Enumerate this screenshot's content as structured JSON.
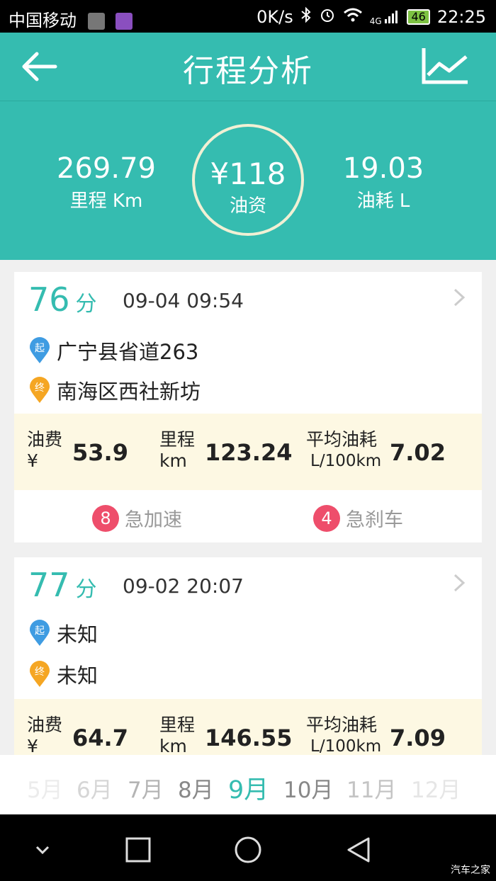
{
  "status_bar": {
    "carrier": "中国移动",
    "speed": "0K/s",
    "network": "4G",
    "battery": "46",
    "time": "22:25"
  },
  "header": {
    "title": "行程分析",
    "back_icon": "back-arrow-icon",
    "chart_icon": "line-chart-icon"
  },
  "summary": {
    "mileage": {
      "value": "269.79",
      "label": "里程 Km"
    },
    "cost": {
      "value": "¥118",
      "label": "油资"
    },
    "fuel": {
      "value": "19.03",
      "label": "油耗 L"
    }
  },
  "trips": [
    {
      "score": "76",
      "score_unit": "分",
      "datetime": "09-04 09:54",
      "start": "广宁县省道263",
      "end": "南海区西社新坊",
      "fee_label": "油费",
      "fee_unit": "¥",
      "fee": "53.9",
      "dist_label": "里程",
      "dist_unit": "km",
      "dist": "123.24",
      "avg_label": "平均油耗",
      "avg_unit": "L/100km",
      "avg": "7.02",
      "accel_count": "8",
      "accel_label": "急加速",
      "brake_count": "4",
      "brake_label": "急刹车"
    },
    {
      "score": "77",
      "score_unit": "分",
      "datetime": "09-02 20:07",
      "start": "未知",
      "end": "未知",
      "fee_label": "油费",
      "fee_unit": "¥",
      "fee": "64.7",
      "dist_label": "里程",
      "dist_unit": "km",
      "dist": "146.55",
      "avg_label": "平均油耗",
      "avg_unit": "L/100km",
      "avg": "7.09"
    }
  ],
  "pins": {
    "start": "起",
    "end": "终"
  },
  "months": [
    "5月",
    "6月",
    "7月",
    "8月",
    "9月",
    "10月",
    "11月",
    "12月"
  ],
  "selected_month": "9月",
  "watermark": "汽车之家",
  "colors": {
    "accent": "#35bcb0",
    "badge": "#ee4e6b",
    "metrics_bg": "#fdf8e3"
  }
}
